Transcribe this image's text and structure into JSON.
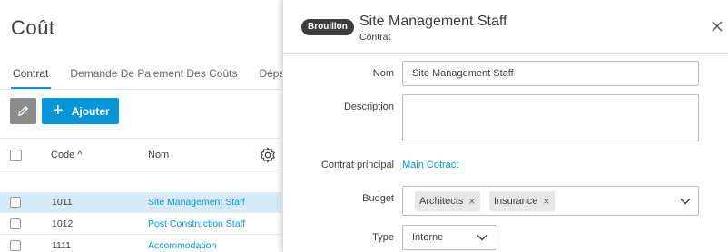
{
  "page": {
    "title": "Coût",
    "tabs": [
      {
        "label": "Contrat"
      },
      {
        "label": "Demande De Paiement Des Coûts"
      },
      {
        "label": "Dépen"
      }
    ],
    "add_label": "Ajouter"
  },
  "table": {
    "headers": {
      "code": "Code ^",
      "nom": "Nom"
    },
    "rows": [
      {
        "code": "1011",
        "nom": "Site Management Staff"
      },
      {
        "code": "1012",
        "nom": "Post Construction Staff"
      },
      {
        "code": "1111",
        "nom": "Accommodation"
      }
    ]
  },
  "panel": {
    "badge": "Brouillon",
    "title": "Site Management Staff",
    "subtitle": "Contrat",
    "fields": {
      "nom_label": "Nom",
      "nom_value": "Site Management Staff",
      "description_label": "Description",
      "description_value": "",
      "contrat_principal_label": "Contrat principal",
      "contrat_principal_value": "Main Cotract",
      "budget_label": "Budget",
      "budget_chips": [
        "Architects",
        "Insurance"
      ],
      "type_label": "Type",
      "type_value": "Interne"
    }
  },
  "colors": {
    "accent": "#0696d7",
    "selected_row": "#d6ebf7",
    "badge": "#3c3c3c"
  }
}
